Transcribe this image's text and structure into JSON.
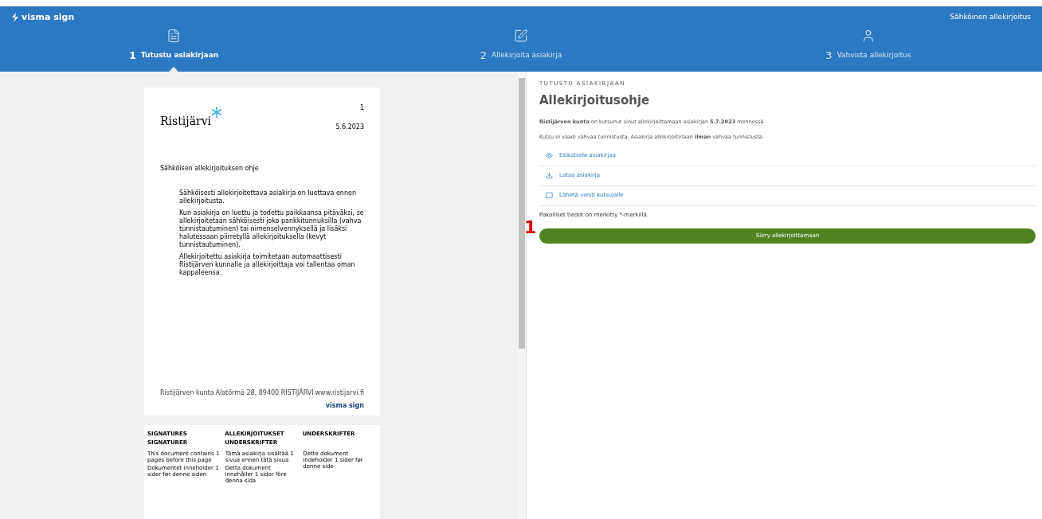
{
  "header": {
    "logo": "visma sign",
    "service": "Sähköinen allekirjoitus"
  },
  "steps": [
    {
      "number": "1",
      "label": "Tutustu asiakirjaan",
      "selected": true
    },
    {
      "number": "2",
      "label": "Allekirjoita asiakirja",
      "selected": false
    },
    {
      "number": "3",
      "label": "Vahvista allekirjoitus",
      "selected": false
    }
  ],
  "document": {
    "page_number": "1",
    "org_logo": "Ristijärvi",
    "date": "5.6.2023",
    "heading": "Sähköisen allekirjoituksen ohje",
    "paragraphs": [
      "Sähköisesti allekirjoitettava asiakirja on luettava ennen allekirjoitusta.",
      "Kun asiakirja on luettu ja todettu paikkaansa pitäväksi, se allekirjoitetaan sähköisesti joko pankkitunnuksilla (vahva tunnistautuminen) tai nimenselvennyksellä ja lisäksi halutessaan piirretyllä allekirjoituksella (kevyt tunnistautuminen).",
      "Allekirjoitettu asiakirja toimitetaan automaattisesti Ristijärven kunnalle ja allekirjoittaja voi tallentaa oman kappaleensa."
    ],
    "footer": [
      "Ristijärven kunta",
      "Alatörmä 28, 89400 RISTIJÄRVI",
      "www.ristijarvi.fi"
    ],
    "footer_logo": "visma sign",
    "signature_headings": [
      "SIGNATURES",
      "ALLEKIRJOITUKSET",
      "UNDERSKRIFTER",
      "SIGNATURER",
      "UNDERSKRIFTER"
    ],
    "signature_notes": [
      [
        "This document contains 1 pages before this page",
        "Dokumentet inneholder 1 sider før denne siden"
      ],
      [
        "Tämä asiakirja sisältää 1 sivua ennen tätä sivua",
        "Detta dokument innehåller 1 sidor före denna sida"
      ],
      [
        "Dette dokument indeholder 1 sider før denne side"
      ]
    ]
  },
  "panel": {
    "eyebrow": "TUTUSTU ASIAKIRJAAN",
    "title": "Allekirjoitusohje",
    "invite": "**Ristijärven kunta** on kutsunut sinut allekirjoittamaan asiakirjan **5.7.2023** mennessä.",
    "auth_note": "Kutsu ei vaadi vahvaa tunnistusta. Asiakirja allekirjoitetaan **ilman** vahvaa tunnistusta.",
    "actions": [
      {
        "label": "Esikatsele asiakirjaa"
      },
      {
        "label": "Lataa asiakirja"
      },
      {
        "label": "Lähetä viesti kutsujalle"
      }
    ],
    "required_note": "Pakolliset tiedot on merkitty *-merkillä.",
    "annotation": "1",
    "primary_button": "Siirry allekirjoittamaan"
  }
}
